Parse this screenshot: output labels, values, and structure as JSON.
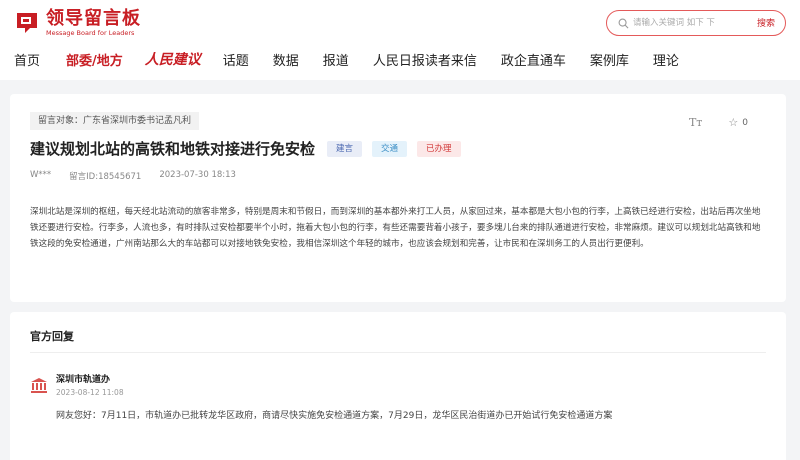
{
  "brand": {
    "title": "领导留言板",
    "subtitle": "Message Board for Leaders",
    "color": "#c81e24"
  },
  "search": {
    "placeholder": "请输入关键词 如下 下",
    "button": "搜索"
  },
  "nav": {
    "items": [
      {
        "label": "首页"
      },
      {
        "label": "部委/地方"
      },
      {
        "label": "人民建议"
      },
      {
        "label": "话题"
      },
      {
        "label": "数据"
      },
      {
        "label": "报道"
      },
      {
        "label": "人民日报读者来信"
      },
      {
        "label": "政企直通车"
      },
      {
        "label": "案例库"
      },
      {
        "label": "理论"
      }
    ],
    "active_index": 1
  },
  "message": {
    "target": "留言对象：广东省深圳市委书记孟凡利",
    "title": "建议规划北站的高铁和地铁对接进行免安检",
    "tags": {
      "type": "建言",
      "topic": "交通",
      "status": "已办理"
    },
    "author": "W***",
    "id": "留言ID:18545671",
    "time": "2023-07-30 18:13",
    "content": "深圳北站是深圳的枢纽，每天经北站流动的旅客非常多，特别是周末和节假日，而到深圳的基本都外来打工人员，从家回过来，基本都是大包小包的行李，上高铁已经进行安检，出站后再次坐地铁还要进行安检。行李多，人流也多，有时排队过安检都要半个小时，拖着大包小包的行李，有些还需要背着小孩子，要多塊儿台来的排队通道进行安检，非常麻烦。建议可以规划北站高铁和地铁这段的免安检通道，广州南站那么大的车站都可以对接地铁免安检，我相信深圳这个年轻的城市，也应该会规划和完善，让市民和在深圳务工的人员出行更便利。",
    "star_count": "0",
    "font_tool": "Tт"
  },
  "reply": {
    "header": "官方回复",
    "org": "深圳市轨道办",
    "time": "2023-08-12 11:08",
    "body": "网友您好：7月11日，市轨道办已批转龙华区政府，商请尽快实施免安检通道方案，7月29日，龙华区民治街道办已开始试行免安检通道方案"
  }
}
